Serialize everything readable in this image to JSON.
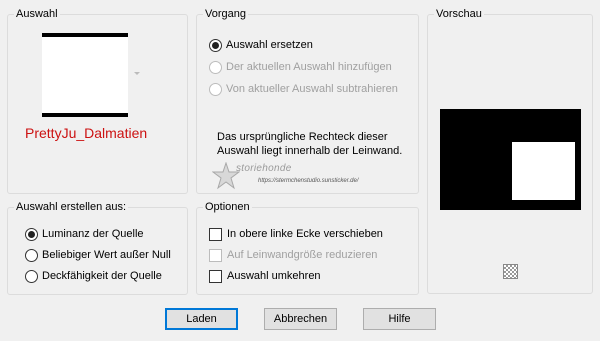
{
  "selection_group": {
    "title": "Auswahl",
    "source_name": "PrettyJu_Dalmatien",
    "source_color": "#cc1111"
  },
  "process_group": {
    "title": "Vorgang",
    "options": [
      {
        "label": "Auswahl ersetzen",
        "selected": true,
        "enabled": true
      },
      {
        "label": "Der aktuellen Auswahl hinzufügen",
        "selected": false,
        "enabled": false
      },
      {
        "label": "Von aktueller Auswahl subtrahieren",
        "selected": false,
        "enabled": false
      }
    ],
    "info_text": "Das ursprüngliche Rechteck dieser Auswahl liegt innerhalb der Leinwand."
  },
  "preview_group": {
    "title": "Vorschau",
    "zoom_icon": "checkerboard-icon"
  },
  "create_group": {
    "title": "Auswahl erstellen aus:",
    "options": [
      {
        "label": "Luminanz der Quelle",
        "selected": true
      },
      {
        "label": "Beliebiger Wert außer Null",
        "selected": false
      },
      {
        "label": "Deckfähigkeit der Quelle",
        "selected": false
      }
    ]
  },
  "options_group": {
    "title": "Optionen",
    "checks": [
      {
        "label": "In obere linke Ecke verschieben",
        "checked": false,
        "enabled": true
      },
      {
        "label": "Auf Leinwandgröße reduzieren",
        "checked": false,
        "enabled": false
      },
      {
        "label": "Auswahl umkehren",
        "checked": false,
        "enabled": true
      }
    ]
  },
  "watermark": {
    "brand": "storiehonde",
    "url": "https://stermchenstudio.sunsticker.de/"
  },
  "buttons": {
    "load": "Laden",
    "cancel": "Abbrechen",
    "help": "Hilfe"
  }
}
